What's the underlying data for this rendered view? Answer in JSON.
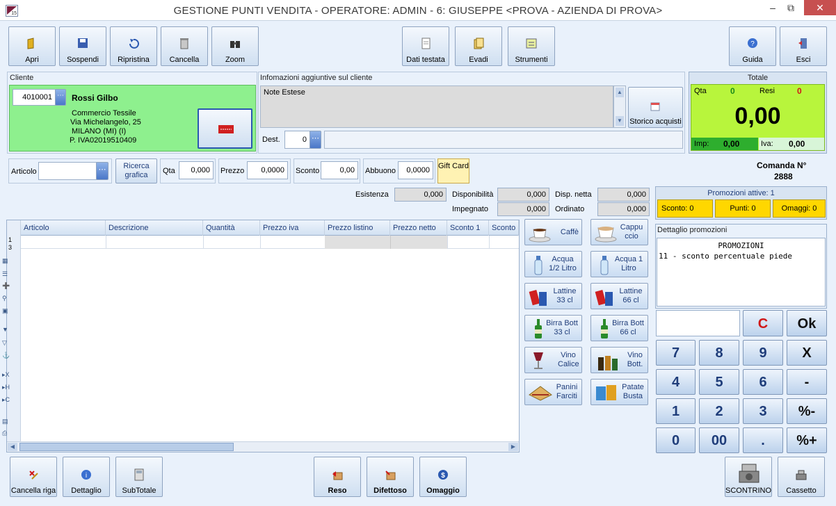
{
  "window": {
    "title": "GESTIONE PUNTI VENDITA - OPERATORE: ADMIN - 6: GIUSEPPE <PROVA - AZIENDA DI PROVA>",
    "icon_number": "15"
  },
  "toolbar": {
    "apri": "Apri",
    "sospendi": "Sospendi",
    "ripristina": "Ripristina",
    "cancella": "Cancella",
    "zoom": "Zoom",
    "dati_testata": "Dati testata",
    "evadi": "Evadi",
    "strumenti": "Strumenti",
    "guida": "Guida",
    "esci": "Esci"
  },
  "cliente": {
    "title": "Cliente",
    "code": "4010001",
    "name": "Rossi Gilbo",
    "line1": "Commercio Tessile",
    "line2": "Via Michelangelo, 25",
    "line3": "MILANO (MI)   (I)",
    "line4": "P. IVA02019510409"
  },
  "info": {
    "title": "Infomazioni aggiuntive sul cliente",
    "note": "Note Estese",
    "storico": "Storico acquisti",
    "dest_label": "Dest.",
    "dest_value": "0"
  },
  "totale": {
    "title": "Totale",
    "qta_label": "Qta",
    "qta_value": "0",
    "resi_label": "Resi",
    "resi_value": "0",
    "amount": "0,00",
    "imp_label": "Imp:",
    "imp_value": "0,00",
    "iva_label": "Iva:",
    "iva_value": "0,00"
  },
  "entry": {
    "articolo": "Articolo",
    "ricerca": "Ricerca grafica",
    "qta": "Qta",
    "qta_value": "0,000",
    "prezzo": "Prezzo",
    "prezzo_value": "0,0000",
    "sconto": "Sconto",
    "sconto_value": "0,00",
    "abbuono": "Abbuono",
    "abbuono_value": "0,0000",
    "gift": "Gift Card"
  },
  "comanda": {
    "label": "Comanda N°",
    "number": "2888"
  },
  "stock": {
    "esistenza": "Esistenza",
    "esistenza_value": "0,000",
    "disponibilita": "Disponibilità",
    "disponibilita_value": "0,000",
    "disp_netta": "Disp. netta",
    "disp_netta_value": "0,000",
    "impegnato": "Impegnato",
    "impegnato_value": "0,000",
    "ordinato": "Ordinato",
    "ordinato_value": "0,000"
  },
  "grid": {
    "columns": [
      "Articolo",
      "Descrizione",
      "Quantità",
      "Prezzo iva",
      "Prezzo listino",
      "Prezzo netto",
      "Sconto 1",
      "Sconto"
    ],
    "row_number": "1",
    "row_count": "3"
  },
  "products": [
    {
      "label": "Caffè"
    },
    {
      "label": "Cappu ccio"
    },
    {
      "label": "Acqua 1/2 Litro"
    },
    {
      "label": "Acqua 1 Litro"
    },
    {
      "label": "Lattine 33 cl"
    },
    {
      "label": "Lattine 66 cl"
    },
    {
      "label": "Birra Bott 33 cl"
    },
    {
      "label": "Birra Bott 66 cl"
    },
    {
      "label": "Vino Calice"
    },
    {
      "label": "Vino Bott."
    },
    {
      "label": "Panini Farciti"
    },
    {
      "label": "Patate Busta"
    }
  ],
  "promo": {
    "title": "Promozioni attive: 1",
    "sconto": "Sconto: 0",
    "punti": "Punti: 0",
    "omaggi": "Omaggi: 0",
    "detail_title": "Dettaglio promozioni",
    "detail_header": "PROMOZIONI",
    "detail_line": "11 - sconto percentuale piede"
  },
  "keypad": {
    "c": "C",
    "ok": "Ok",
    "k7": "7",
    "k8": "8",
    "k9": "9",
    "x": "X",
    "k4": "4",
    "k5": "5",
    "k6": "6",
    "minus": "-",
    "k1": "1",
    "k2": "2",
    "k3": "3",
    "pmin": "%-",
    "k0": "0",
    "k00": "00",
    "dot": ".",
    "pplus": "%+"
  },
  "bottom": {
    "cancella_riga": "Cancella riga",
    "dettaglio": "Dettaglio",
    "subtotale": "SubTotale",
    "reso": "Reso",
    "difettoso": "Difettoso",
    "omaggio": "Omaggio",
    "scontrino": "SCONTRINO",
    "cassetto": "Cassetto"
  },
  "colors": {
    "green_panel": "#8ef08e",
    "total_panel": "#b8f53c",
    "promo_yellow": "#ffd700",
    "gift_yellow": "#fff2b3",
    "accent_red": "#d01818"
  }
}
